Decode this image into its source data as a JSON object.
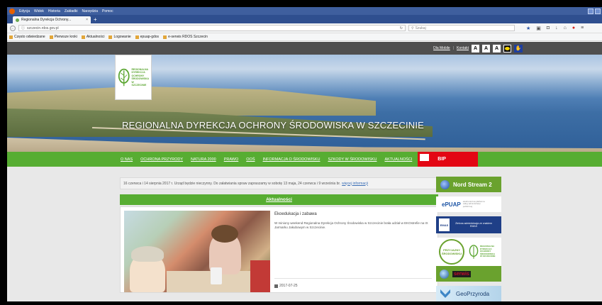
{
  "browser": {
    "menu": [
      "Edycja",
      "Widok",
      "Historia",
      "Zakładki",
      "Narzędzia",
      "Pomoc"
    ],
    "tab_title": "Regionalna Dyrekcja Ochrony...",
    "url": "szczecin.rdos.gov.pl",
    "search_placeholder": "Szukaj",
    "bookmarks": [
      "Często odwiedzane",
      "Pierwsze kroki",
      "Aktualności",
      "Logowanie",
      "epuap-gdos",
      "e-serwis RDOS Szczecin"
    ]
  },
  "topbar": {
    "mobile": "Dla Mobile",
    "contact": "Kontakt",
    "font_small": "A",
    "font_medium": "A",
    "font_large": "A"
  },
  "logo_text": "REGIONALNA\nDYREKCJA\nOCHRONY\nŚRODOWISKA\nW SZCZECINIE",
  "banner_title": "REGIONALNA DYREKCJA OCHRONY ŚRODOWISKA W SZCZECINIE",
  "nav": [
    "O NAS",
    "OCHRONA PRZYRODY",
    "NATURA 2000",
    "PRAWO",
    "OOŚ",
    "INFORMACJA O ŚRODOWISKU",
    "SZKODY W ŚRODOWISKU",
    "AKTUALNOŚCI"
  ],
  "bip": "BIP",
  "notice": {
    "text": "16 czerwca i 14 sierpnia 2017 r. Urząd będzie nieczynny. Do załatwiania spraw zapraszamy w sobotę 13 maja, 24 czerwca i 9 września br.",
    "link": "więcej informacji"
  },
  "section_title": "Aktualności",
  "article": {
    "title": "Ekoedukacja i zabawa",
    "text": "W miniony weekend Regionalna Dyrekcja Ochrony Środowiska w Szczecinie brała udział w EKOstrefie na IX Jarmarku Jakubowym w Szczecinie.",
    "date": "2017-07-25"
  },
  "sidebar": {
    "nord_stream": "Nord Stream 2",
    "epuap": "ePUAP",
    "epuap_sub": "elektroniczna platforma usług administracji publicznej",
    "emas": "Zielona administracja ze znakiem EMAS",
    "emas_badge": "EMAS",
    "seal": "PRZYJAZNY ŚRODOWISKU",
    "gios": "serwis",
    "geo": "GeoPrzyroda"
  }
}
